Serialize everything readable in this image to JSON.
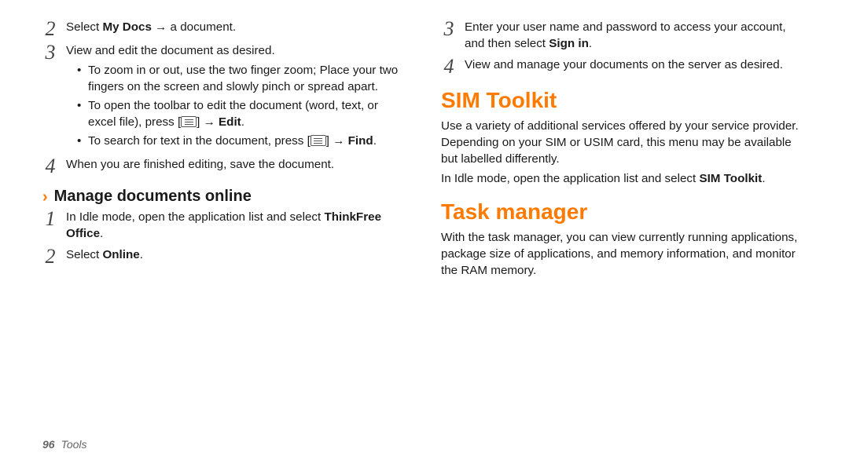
{
  "left": {
    "step2": {
      "n": "2",
      "prefix": "Select ",
      "bold": "My Docs",
      "suffix": " → a document."
    },
    "step3": {
      "n": "3",
      "text": "View and edit the document as desired.",
      "b1": "To zoom in or out, use the two finger zoom; Place your two fingers on the screen and slowly pinch or spread apart.",
      "b2_prefix": "To open the toolbar to edit the document (word, text, or excel file), press [",
      "b2_mid": "] → ",
      "b2_bold": "Edit",
      "b2_end": ".",
      "b3_prefix": "To search for text in the document, press [",
      "b3_mid": "] → ",
      "b3_bold": "Find",
      "b3_end": "."
    },
    "step4": {
      "n": "4",
      "text": "When you are finished editing, save the document."
    },
    "sub": {
      "title": "Manage documents online"
    },
    "sub_step1": {
      "n": "1",
      "prefix": "In Idle mode, open the application list and select ",
      "bold": "ThinkFree Office",
      "suffix": "."
    },
    "sub_step2": {
      "n": "2",
      "prefix": "Select ",
      "bold": "Online",
      "suffix": "."
    }
  },
  "right": {
    "step3": {
      "n": "3",
      "prefix": "Enter your user name and password to access your account, and then select ",
      "bold": "Sign in",
      "suffix": "."
    },
    "step4": {
      "n": "4",
      "text": "View and manage your documents on the server as desired."
    },
    "sim": {
      "heading": "SIM Toolkit",
      "p1": "Use a variety of additional services offered by your service provider. Depending on your SIM or USIM card, this menu may be available but labelled differently.",
      "p2_prefix": "In Idle mode, open the application list and select ",
      "p2_bold": "SIM Toolkit",
      "p2_suffix": "."
    },
    "task": {
      "heading": "Task manager",
      "p1": "With the task manager, you can view currently running applications, package size of applications, and memory information, and monitor the RAM memory."
    }
  },
  "footer": {
    "page": "96",
    "section": "Tools"
  }
}
